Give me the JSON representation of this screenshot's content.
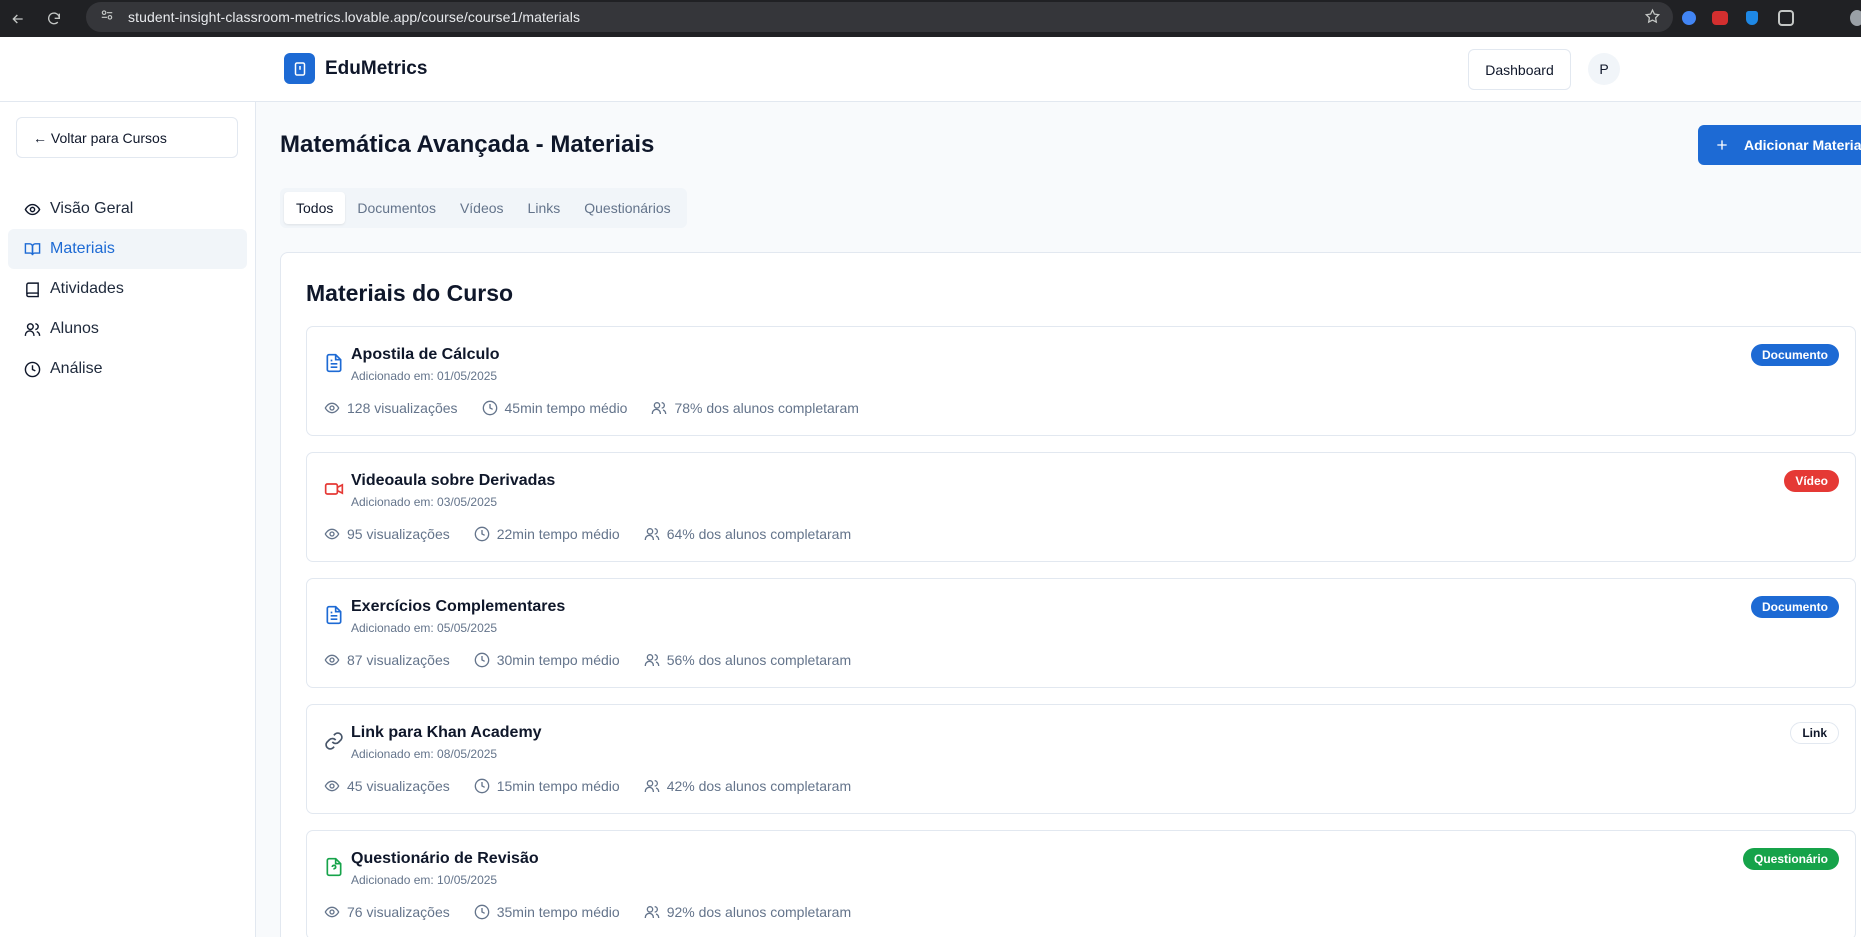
{
  "browser": {
    "url": "student-insight-classroom-metrics.lovable.app/course/course1/materials"
  },
  "header": {
    "brand": "EduMetrics",
    "dashboard_label": "Dashboard",
    "avatar_initial": "P"
  },
  "sidebar": {
    "back_label": "← Voltar para Cursos",
    "items": [
      {
        "label": "Visão Geral",
        "icon": "eye-icon"
      },
      {
        "label": "Materiais",
        "icon": "book-open-icon"
      },
      {
        "label": "Atividades",
        "icon": "book-icon"
      },
      {
        "label": "Alunos",
        "icon": "users-icon"
      },
      {
        "label": "Análise",
        "icon": "clock-icon"
      }
    ]
  },
  "main": {
    "title": "Matemática Avançada - Materiais",
    "add_button": "Adicionar Material",
    "tabs": [
      "Todos",
      "Documentos",
      "Vídeos",
      "Links",
      "Questionários"
    ],
    "card_title": "Materiais do Curso",
    "materials": [
      {
        "name": "Apostila de Cálculo",
        "date": "Adicionado em: 01/05/2025",
        "views": "128 visualizações",
        "time": "45min tempo médio",
        "completion": "78% dos alunos completaram",
        "badge": "Documento",
        "icon": "document-icon"
      },
      {
        "name": "Videoaula sobre Derivadas",
        "date": "Adicionado em: 03/05/2025",
        "views": "95 visualizações",
        "time": "22min tempo médio",
        "completion": "64% dos alunos completaram",
        "badge": "Vídeo",
        "icon": "video-icon"
      },
      {
        "name": "Exercícios Complementares",
        "date": "Adicionado em: 05/05/2025",
        "views": "87 visualizações",
        "time": "30min tempo médio",
        "completion": "56% dos alunos completaram",
        "badge": "Documento",
        "icon": "document-icon"
      },
      {
        "name": "Link para Khan Academy",
        "date": "Adicionado em: 08/05/2025",
        "views": "45 visualizações",
        "time": "15min tempo médio",
        "completion": "42% dos alunos completaram",
        "badge": "Link",
        "icon": "link-icon"
      },
      {
        "name": "Questionário de Revisão",
        "date": "Adicionado em: 10/05/2025",
        "views": "76 visualizações",
        "time": "35min tempo médio",
        "completion": "92% dos alunos completaram",
        "badge": "Questionário",
        "icon": "quiz-icon"
      }
    ]
  },
  "colors": {
    "primary": "#1d6ad4",
    "document_icon": "#1d6ad4",
    "video_icon": "#e53935",
    "link_icon": "#475569",
    "quiz_icon": "#16a34a",
    "badge_document": "#1d6ad4",
    "badge_video": "#e53935",
    "badge_quiz": "#16a34a"
  }
}
